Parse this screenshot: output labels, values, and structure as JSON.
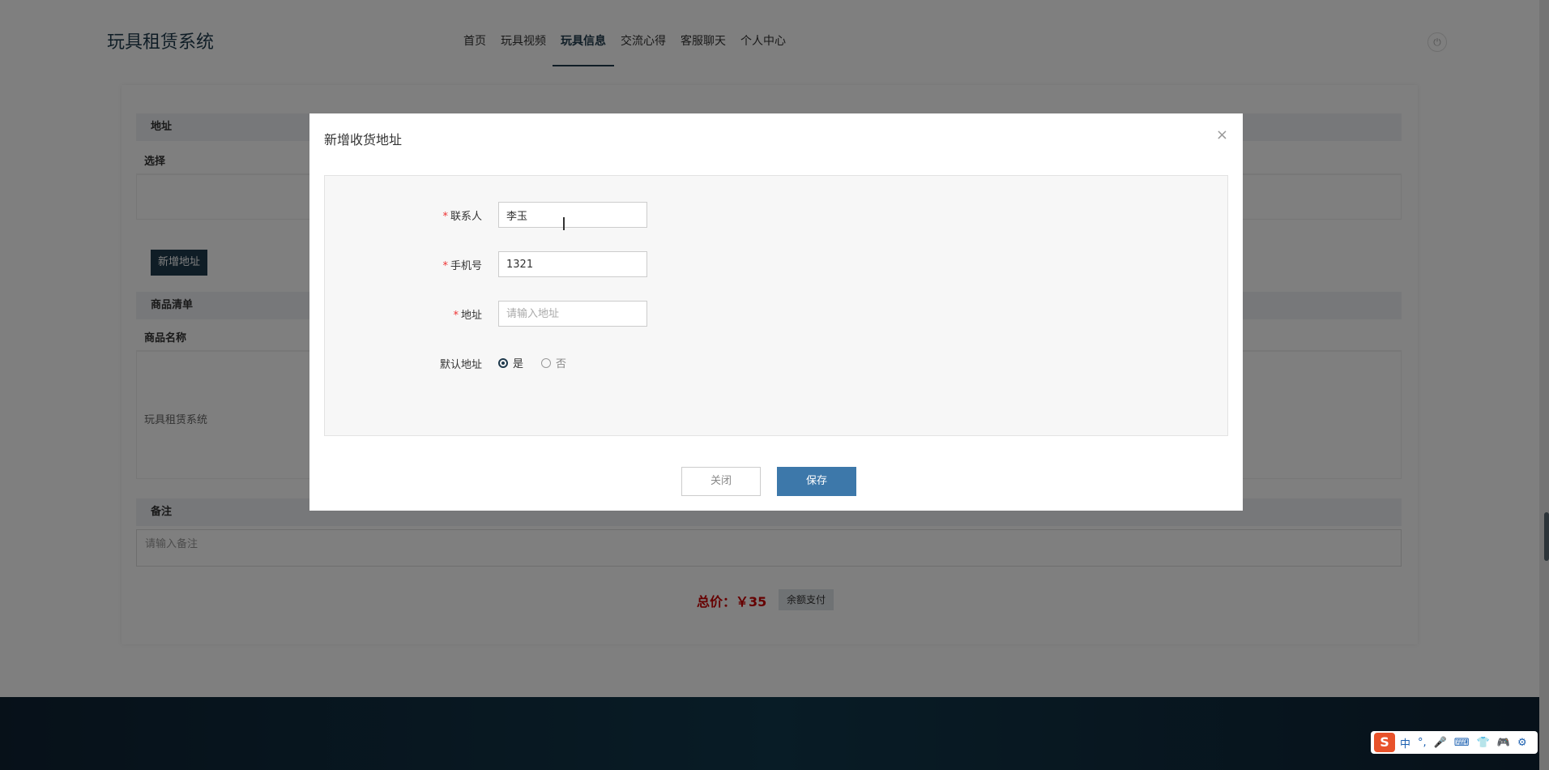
{
  "header": {
    "logo": "玩具租赁系统",
    "nav": [
      "首页",
      "玩具视频",
      "玩具信息",
      "交流心得",
      "客服聊天",
      "个人中心"
    ],
    "active_nav": "玩具信息",
    "power_icon": "power-icon"
  },
  "background": {
    "address_section": "地址",
    "select_label": "选择",
    "add_address_button": "新增地址",
    "goods_section": "商品清单",
    "goods_name_header": "商品名称",
    "goods_name": "玩具租赁系统",
    "remark_section": "备注",
    "remark_placeholder": "请输入备注",
    "total_label": "总价：￥35",
    "pay_button": "余额支付"
  },
  "modal": {
    "title": "新增收货地址",
    "close_symbol": "×",
    "fields": {
      "contact": {
        "label": "联系人",
        "value": "李玉",
        "required": true
      },
      "phone": {
        "label": "手机号",
        "value": "1321",
        "required": true
      },
      "address": {
        "label": "地址",
        "placeholder": "请输入地址",
        "required": true
      }
    },
    "default_address": {
      "label": "默认地址",
      "options": [
        "是",
        "否"
      ],
      "selected": "是"
    },
    "required_mark": "*",
    "close_button": "关闭",
    "save_button": "保存"
  },
  "ime": {
    "logo": "S",
    "items": [
      "中",
      "°,",
      "🎤",
      "⌨",
      "👕",
      "🎮",
      "⚙"
    ]
  },
  "colors": {
    "primary": "#1f3a4d",
    "save": "#3d78aa",
    "price": "#cc0000"
  }
}
